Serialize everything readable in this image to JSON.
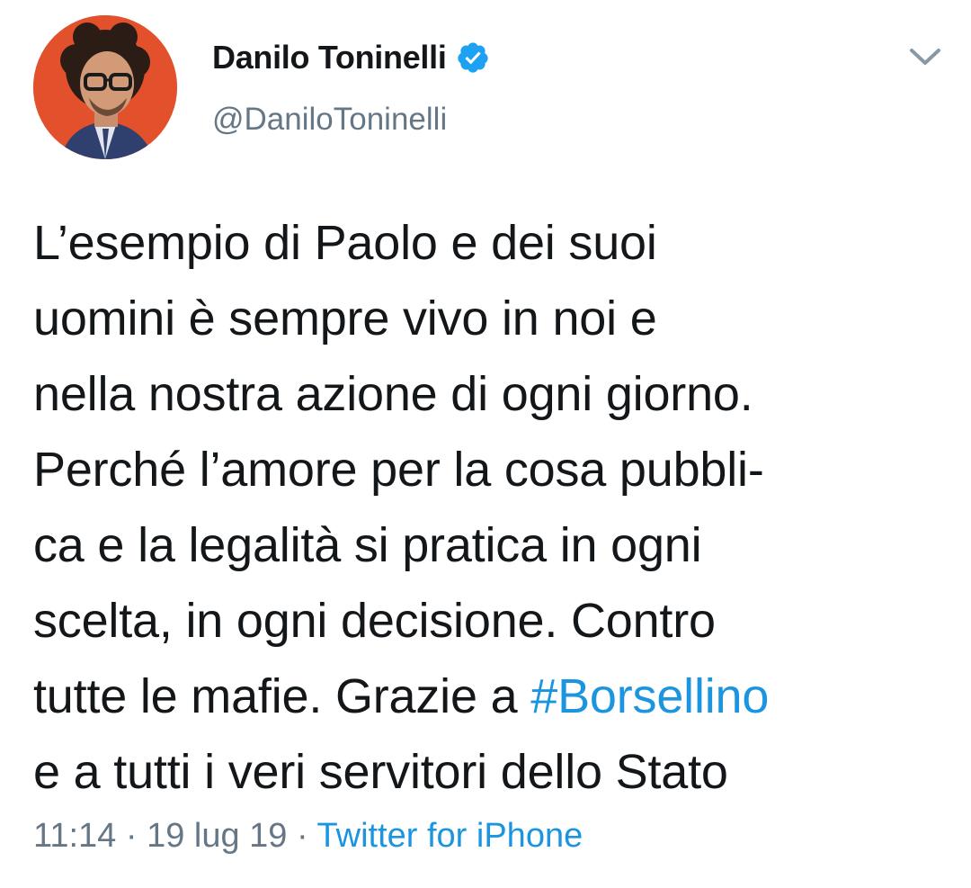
{
  "user": {
    "display_name": "Danilo Toninelli",
    "handle": "@DaniloToninelli",
    "verified_icon": "verified-badge-icon",
    "avatar_background": "#e3502c"
  },
  "tweet": {
    "lines": [
      "L’esempio di Paolo e dei suoi",
      "uomini è sempre vivo in noi e",
      "nella nostra azione di ogni giorno.",
      "Perché l’amore per la cosa pubbli-",
      "ca e la legalità si pratica in ogni",
      "scelta, in ogni decisione. Contro"
    ],
    "line7_prefix": "tutte le mafie. Grazie a ",
    "hashtag": "#Borsellino",
    "line8": "e a tutti i veri servitori dello Stato"
  },
  "meta": {
    "time": "11:14",
    "sep1": " · ",
    "date": "19 lug 19",
    "sep2": " · ",
    "source": "Twitter for iPhone"
  },
  "icons": {
    "menu": "chevron-down-icon"
  },
  "colors": {
    "link": "#1b95e0",
    "secondary": "#657786",
    "text": "#14171a",
    "verified": "#1da1f2"
  }
}
